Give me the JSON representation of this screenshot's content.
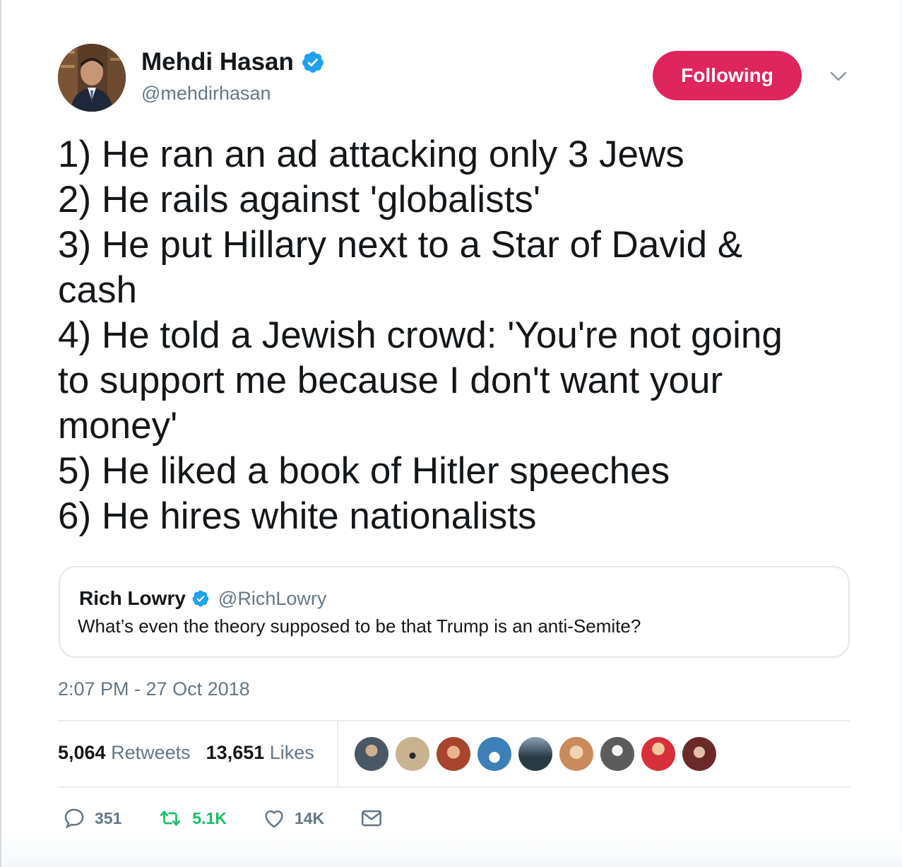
{
  "author": {
    "name": "Mehdi Hasan",
    "handle": "@mehdirhasan",
    "verified_icon": "verified-badge-icon"
  },
  "follow_button": {
    "label": "Following",
    "color": "#e0245e"
  },
  "tweet": {
    "lines": [
      "1) He ran an ad attacking only 3 Jews",
      "2) He rails against 'globalists'",
      "3) He put Hillary next to a Star of David &",
      "cash",
      "4) He told a Jewish crowd: 'You're not going",
      "to support me because I don't want your",
      "money'",
      "5) He liked a book of Hitler speeches",
      "6) He hires white nationalists"
    ]
  },
  "quoted_tweet": {
    "name": "Rich Lowry",
    "handle": "@RichLowry",
    "text": "What’s even the theory supposed to be that Trump is an anti-Semite?"
  },
  "timestamp": "2:07 PM - 27 Oct 2018",
  "stats": {
    "retweets_count": "5,064",
    "retweets_label": "Retweets",
    "likes_count": "13,651",
    "likes_label": "Likes"
  },
  "likers": [
    {
      "icon": "liker-avatar-1",
      "color": "#4a5866"
    },
    {
      "icon": "liker-avatar-2",
      "color": "#c9b28f"
    },
    {
      "icon": "liker-avatar-3",
      "color": "#a8452f"
    },
    {
      "icon": "liker-avatar-4",
      "color": "#3d7fb8"
    },
    {
      "icon": "liker-avatar-5",
      "color": "#2b3b46"
    },
    {
      "icon": "liker-avatar-6",
      "color": "#c98b5b"
    },
    {
      "icon": "liker-avatar-7",
      "color": "#5c5c5c"
    },
    {
      "icon": "liker-avatar-8",
      "color": "#d6313b"
    },
    {
      "icon": "liker-avatar-9",
      "color": "#6b2a2a"
    }
  ],
  "actions": {
    "replies": "351",
    "retweets": "5.1K",
    "likes": "14K"
  },
  "colors": {
    "accent_blue": "#1da1f2",
    "retweet_green": "#17bf63",
    "muted": "#657786"
  }
}
